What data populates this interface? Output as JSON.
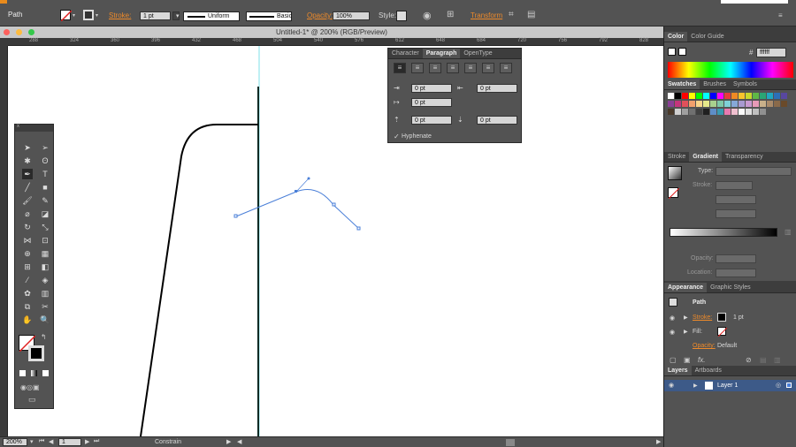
{
  "control": {
    "selection": "Path",
    "stroke_label": "Stroke:",
    "stroke_value": "1 pt",
    "profile": "Uniform",
    "brush": "Basic",
    "opacity_label": "Opacity:",
    "opacity_value": "100%",
    "style_label": "Style:",
    "transform": "Transform"
  },
  "document": {
    "title": "Untitled-1* @ 200% (RGB/Preview)",
    "ruler_ticks": [
      "288",
      "324",
      "360",
      "396",
      "432",
      "468",
      "504",
      "540",
      "576",
      "612",
      "648",
      "684",
      "720",
      "756",
      "792",
      "828"
    ]
  },
  "status": {
    "zoom": "200%",
    "artboard": "1",
    "tool": "Constrain"
  },
  "paragraph": {
    "tabs": [
      "Character",
      "Paragraph",
      "OpenType"
    ],
    "left_indent": "0 pt",
    "right_indent": "0 pt",
    "first_line": "0 pt",
    "space_before": "0 pt",
    "space_after": "0 pt",
    "hyphenate": "Hyphenate"
  },
  "color_panel": {
    "tabs": [
      "Color",
      "Color Guide"
    ],
    "hex_symbol": "#",
    "hex": "ffffff"
  },
  "swatches_panel": {
    "tabs": [
      "Swatches",
      "Brushes",
      "Symbols"
    ]
  },
  "gradient_panel": {
    "tabs": [
      "Stroke",
      "Gradient",
      "Transparency"
    ],
    "type_label": "Type:",
    "stroke_label": "Stroke:",
    "opacity_label": "Opacity:",
    "location_label": "Location:"
  },
  "appearance": {
    "tabs": [
      "Appearance",
      "Graphic Styles"
    ],
    "path": "Path",
    "stroke_label": "Stroke:",
    "stroke_value": "1 pt",
    "fill_label": "Fill:",
    "opacity_label": "Opacity:",
    "opacity_value": "Default",
    "fx": "fx."
  },
  "layers": {
    "tabs": [
      "Layers",
      "Artboards"
    ],
    "layer": "Layer 1"
  },
  "colors": {
    "accent": "#ee8a2a",
    "path_blue": "#4a7fd8",
    "guide_cyan": "#7fe0ea"
  }
}
